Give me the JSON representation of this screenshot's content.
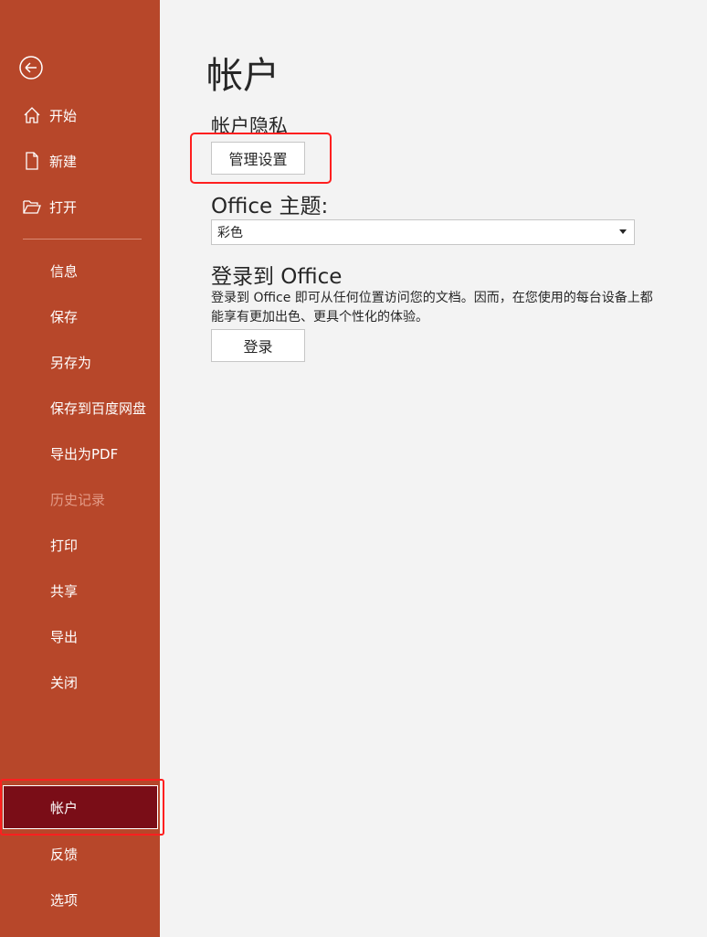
{
  "sidebar": {
    "items": {
      "home": "开始",
      "new": "新建",
      "open": "打开",
      "info": "信息",
      "save": "保存",
      "save_as": "另存为",
      "save_baidu": "保存到百度网盘",
      "export_pdf": "导出为PDF",
      "history": "历史记录",
      "print": "打印",
      "share": "共享",
      "export": "导出",
      "close": "关闭",
      "account": "帐户",
      "feedback": "反馈",
      "options": "选项"
    },
    "selected": "account",
    "disabled": [
      "history"
    ],
    "colors": {
      "background": "#b7472a",
      "selected": "#7a0d17",
      "highlight": "#ff1f1f"
    }
  },
  "main": {
    "title": "帐户",
    "privacy": {
      "label": "帐户隐私",
      "button": "管理设置"
    },
    "theme": {
      "label": "Office 主题:",
      "selected": "彩色"
    },
    "signin": {
      "label": "登录到 Office",
      "description": "登录到 Office 即可从任何位置访问您的文档。因而，在您使用的每台设备上都能享有更加出色、更具个性化的体验。",
      "button": "登录"
    }
  }
}
